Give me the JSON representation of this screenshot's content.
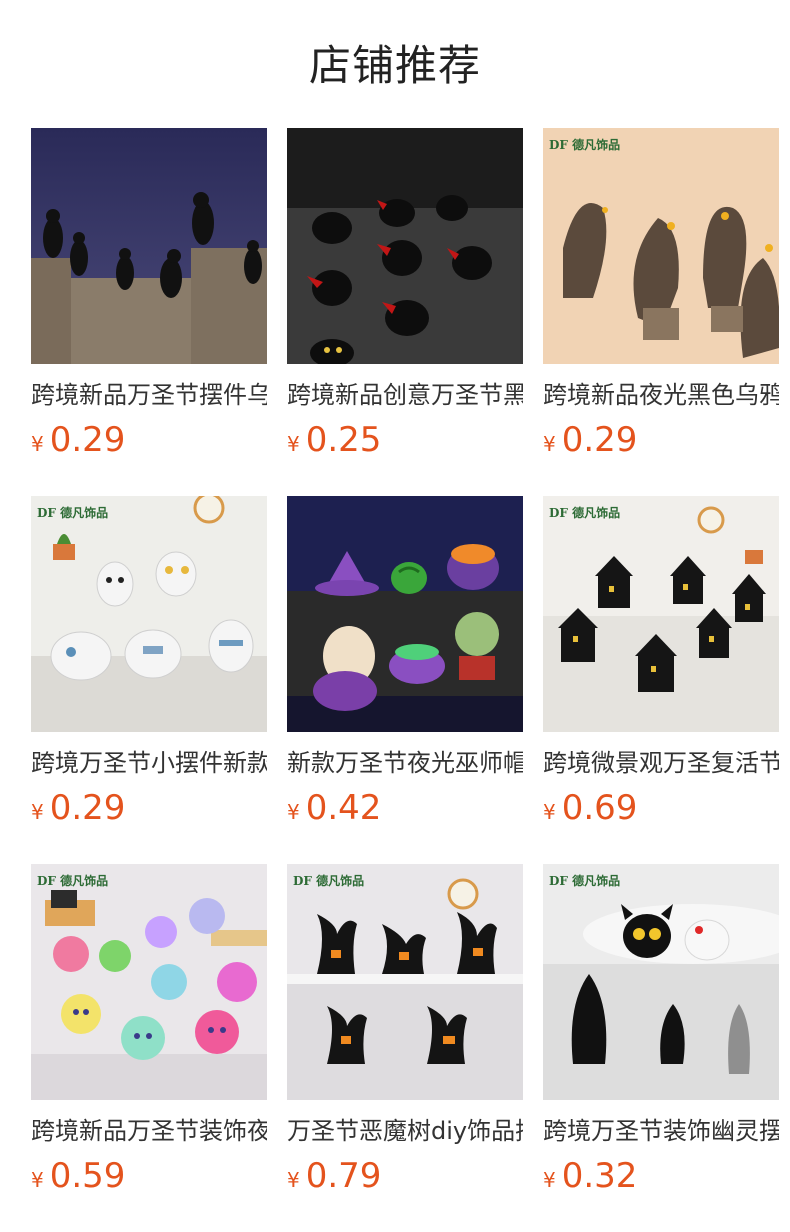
{
  "header": {
    "title": "店铺推荐"
  },
  "products": [
    {
      "name": "跨境新品万圣节摆件乌鸦",
      "price": "0.29",
      "currency": "¥",
      "image": "crows-on-stone-wall"
    },
    {
      "name": "跨境新品创意万圣节黑鸭",
      "price": "0.25",
      "currency": "¥",
      "image": "black-ducks-red-wings"
    },
    {
      "name": "跨境新品夜光黑色乌鸦摆件",
      "price": "0.29",
      "currency": "¥",
      "image": "brown-crows",
      "brand": "DF 德凡饰品"
    },
    {
      "name": "跨境万圣节小摆件新款幽灵",
      "price": "0.29",
      "currency": "¥",
      "image": "white-ghost-figurines",
      "brand": "DF 德凡饰品"
    },
    {
      "name": "新款万圣节夜光巫师帽南瓜",
      "price": "0.42",
      "currency": "¥",
      "image": "glowing-witch-items"
    },
    {
      "name": "跨境微景观万圣复活节小屋",
      "price": "0.69",
      "currency": "¥",
      "image": "black-houses",
      "brand": "DF 德凡饰品"
    },
    {
      "name": "跨境新品万圣节装饰夜光幽灵",
      "price": "0.59",
      "currency": "¥",
      "image": "colorful-ghosts",
      "brand": "DF 德凡饰品"
    },
    {
      "name": "万圣节恶魔树diy饰品摆件",
      "price": "0.79",
      "currency": "¥",
      "image": "evil-trees",
      "brand": "DF 德凡饰品"
    },
    {
      "name": "跨境万圣节装饰幽灵摆件",
      "price": "0.32",
      "currency": "¥",
      "image": "black-cat-ghosts",
      "brand": "DF 德凡饰品"
    }
  ]
}
